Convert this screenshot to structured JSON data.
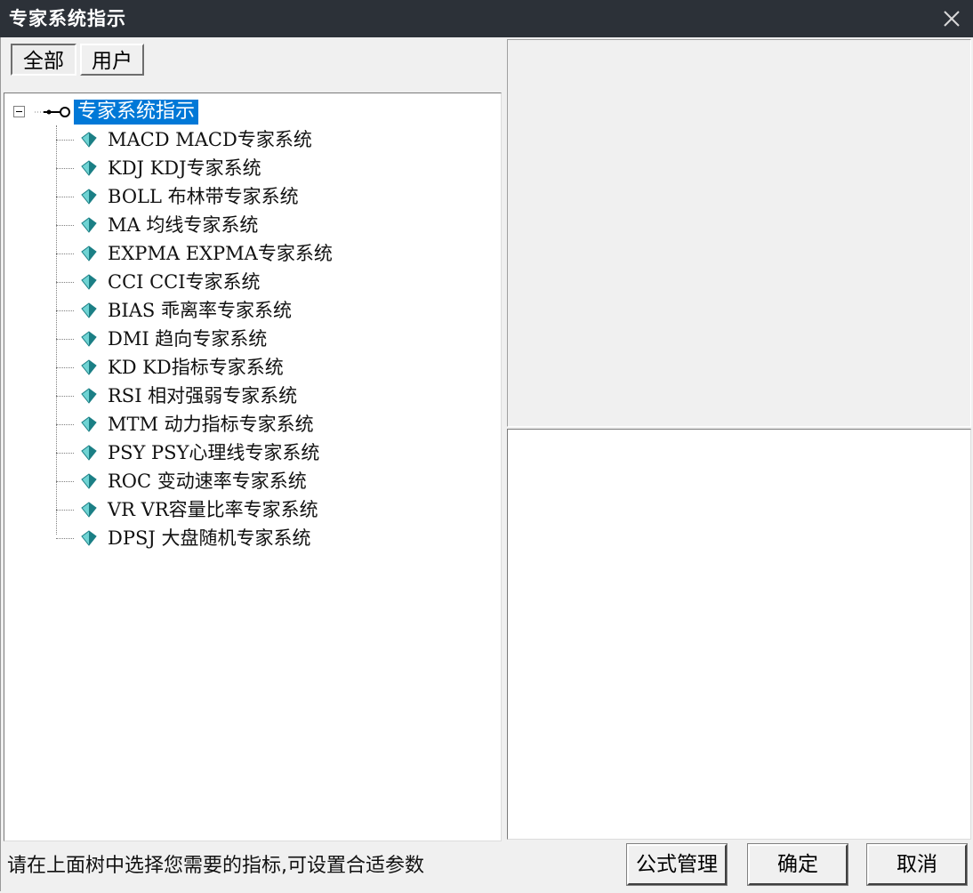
{
  "window": {
    "title": "专家系统指示",
    "close_icon": "close-icon"
  },
  "tabs": [
    {
      "label": "全部",
      "active": true
    },
    {
      "label": "用户",
      "active": false
    }
  ],
  "tree": {
    "root": {
      "label": "专家系统指示",
      "icon": "key-link-icon",
      "expanded": true,
      "selected": true
    },
    "items": [
      {
        "label": "MACD MACD专家系统"
      },
      {
        "label": "KDJ KDJ专家系统"
      },
      {
        "label": "BOLL 布林带专家系统"
      },
      {
        "label": "MA 均线专家系统"
      },
      {
        "label": "EXPMA EXPMA专家系统"
      },
      {
        "label": "CCI CCI专家系统"
      },
      {
        "label": "BIAS 乖离率专家系统"
      },
      {
        "label": "DMI 趋向专家系统"
      },
      {
        "label": "KD KD指标专家系统"
      },
      {
        "label": "RSI 相对强弱专家系统"
      },
      {
        "label": "MTM 动力指标专家系统"
      },
      {
        "label": "PSY PSY心理线专家系统"
      },
      {
        "label": "ROC 变动速率专家系统"
      },
      {
        "label": "VR VR容量比率专家系统"
      },
      {
        "label": "DPSJ 大盘随机专家系统"
      }
    ],
    "item_icon": "diamond-gem-icon",
    "colors": {
      "selection": "#0078d7",
      "gem_light": "#6fd3d3",
      "gem_dark": "#1b7f85"
    }
  },
  "status": {
    "hint": "请在上面树中选择您需要的指标,可设置合适参数"
  },
  "buttons": {
    "formula_manage": "公式管理",
    "ok": "确定",
    "cancel": "取消"
  }
}
